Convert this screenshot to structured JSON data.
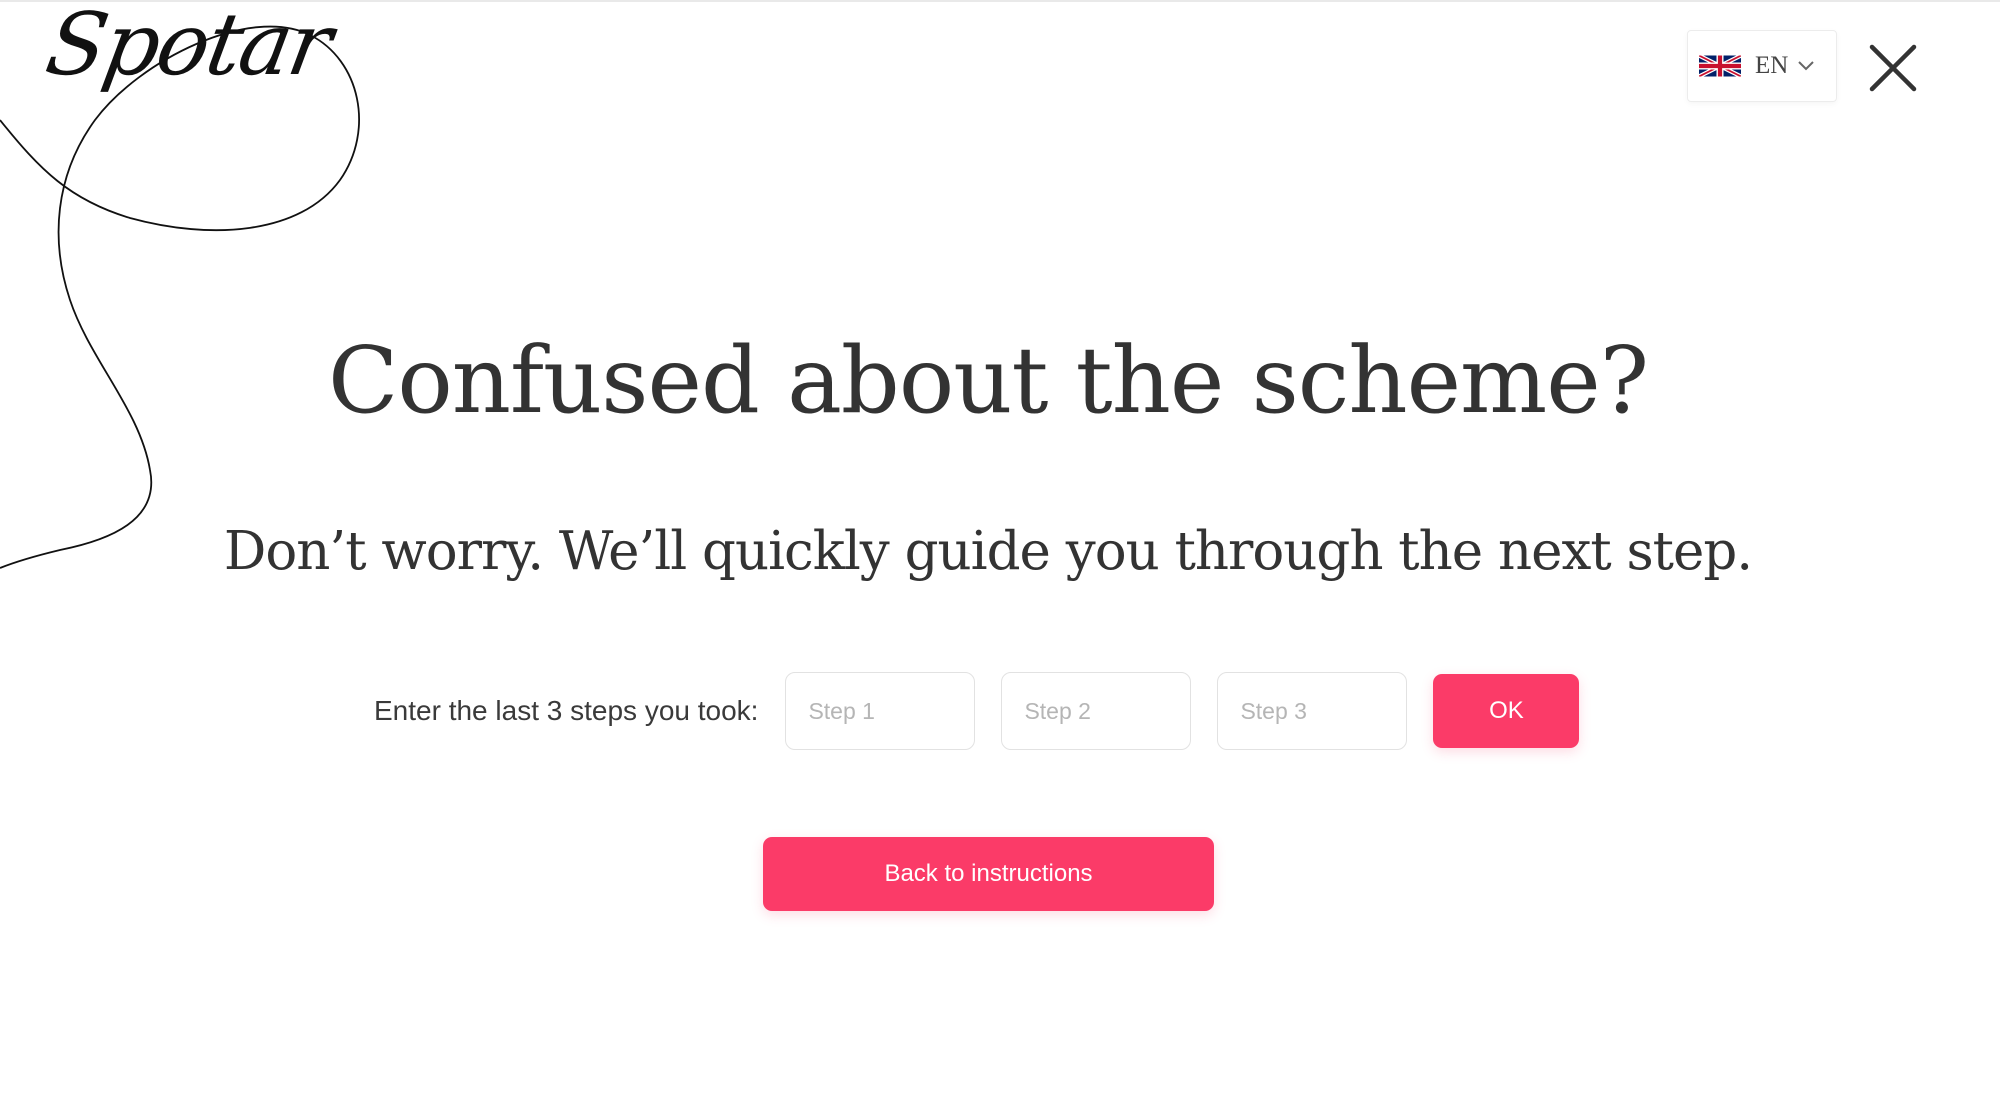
{
  "header": {
    "logo_text": "Spotar",
    "language": {
      "code": "EN",
      "flag_icon": "uk-flag-icon",
      "dropdown_icon": "chevron-down-icon"
    },
    "close_icon": "close-icon"
  },
  "main": {
    "title": "Confused about the scheme?",
    "subtitle": "Don’t worry. We’ll quickly guide you through the next step.",
    "steps_label": "Enter the last 3 steps you took:",
    "steps": [
      {
        "placeholder": "Step 1",
        "value": ""
      },
      {
        "placeholder": "Step 2",
        "value": ""
      },
      {
        "placeholder": "Step 3",
        "value": ""
      }
    ],
    "ok_label": "OK",
    "back_label": "Back to instructions"
  },
  "colors": {
    "accent": "#fb3b68",
    "text": "#333333",
    "background": "#ffffff"
  }
}
